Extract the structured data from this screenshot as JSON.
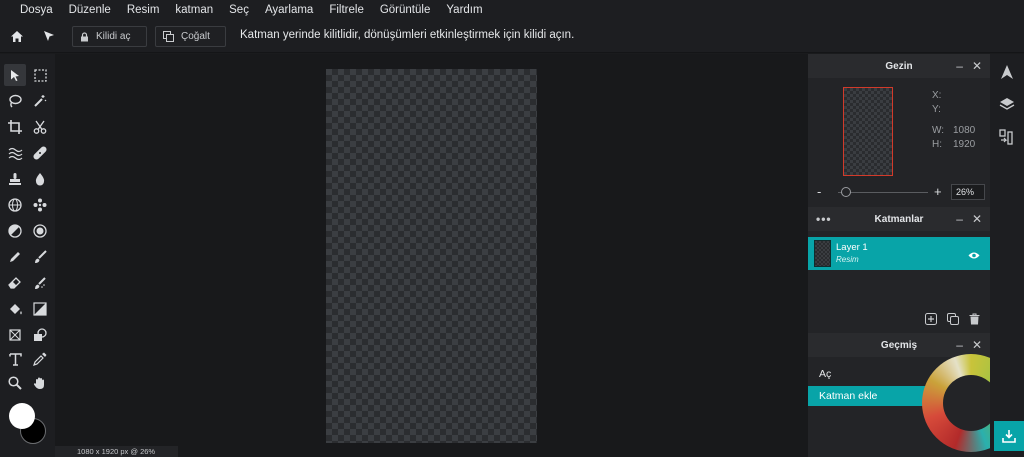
{
  "menu": [
    "Dosya",
    "Düzenle",
    "Resim",
    "katman",
    "Seç",
    "Ayarlama",
    "Filtrele",
    "Görüntüle",
    "Yardım"
  ],
  "options": {
    "unlock_label": "Kilidi aç",
    "duplicate_label": "Çoğalt",
    "message": "Katman yerinde kilitlidir, dönüşümleri etkinleştirmek için kilidi açın."
  },
  "status": "1080 x 1920 px @ 26%",
  "navigator": {
    "title": "Gezin",
    "x_label": "X:",
    "y_label": "Y:",
    "w_label": "W:",
    "h_label": "H:",
    "w_value": "1080",
    "h_value": "1920",
    "zoom": "26%",
    "zoom_minus": "-",
    "zoom_plus": "+"
  },
  "layers": {
    "title": "Katmanlar",
    "items": [
      {
        "name": "Layer 1",
        "type": "Resim"
      }
    ]
  },
  "history": {
    "title": "Geçmiş",
    "items": [
      {
        "label": "Aç"
      },
      {
        "label": "Katman ekle"
      }
    ]
  },
  "colors": {
    "accent": "#08a4a8",
    "foreground": "#ffffff",
    "background": "#000000"
  }
}
